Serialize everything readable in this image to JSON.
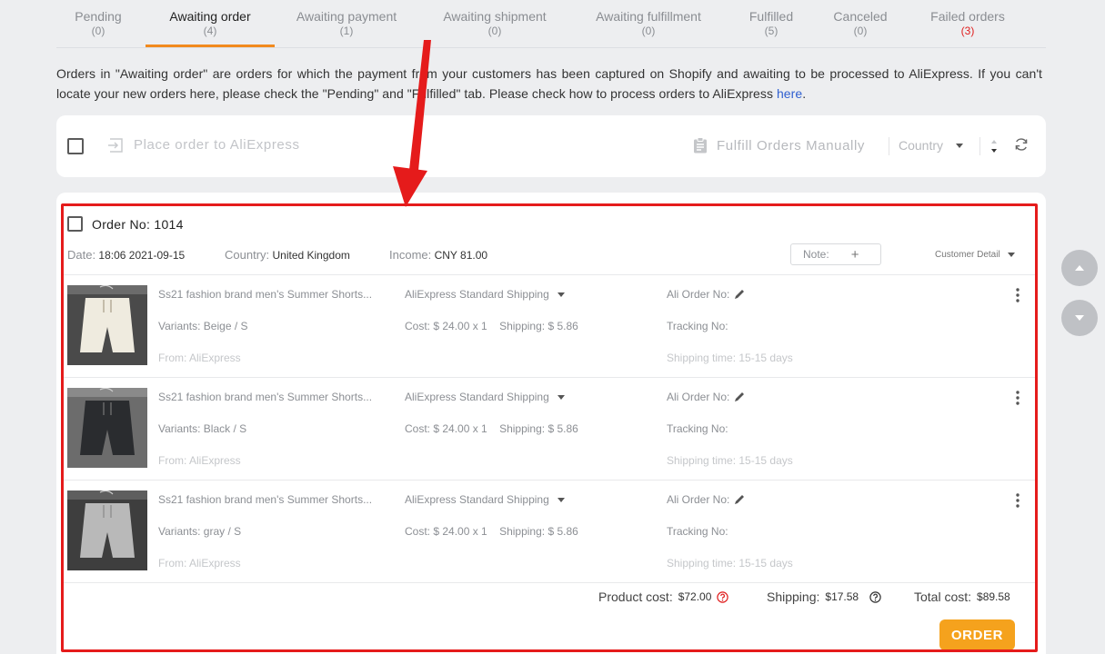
{
  "tabs": [
    {
      "label": "Pending",
      "count": "(0)"
    },
    {
      "label": "Awaiting order",
      "count": "(4)"
    },
    {
      "label": "Awaiting payment",
      "count": "(1)"
    },
    {
      "label": "Awaiting shipment",
      "count": "(0)"
    },
    {
      "label": "Awaiting fulfillment",
      "count": "(0)"
    },
    {
      "label": "Fulfilled",
      "count": "(5)"
    },
    {
      "label": "Canceled",
      "count": "(0)"
    },
    {
      "label": "Failed orders",
      "count": "(3)"
    }
  ],
  "active_tab": "Awaiting order",
  "info": {
    "text": "Orders in \"Awaiting order\" are orders for which the payment from your customers has been captured on Shopify and awaiting to be processed to AliExpress. If you can't locate your new orders here, please check the \"Pending\" and \"Fulfilled\" tab. Please check how to process orders to AliExpress",
    "link": "here",
    "end": "."
  },
  "toolbar": {
    "place_order": "Place order to AliExpress",
    "fulfill_manually": "Fulfill Orders Manually",
    "country": "Country"
  },
  "order": {
    "title": "Order No: 1014",
    "date_label": "Date:",
    "date": "18:06 2021-09-15",
    "country_label": "Country:",
    "country": "United Kingdom",
    "income_label": "Income:",
    "income": "CNY 81.00",
    "note": "Note:",
    "note_plus": "+",
    "customer_detail": "Customer Detail",
    "items": [
      {
        "title": "Ss21 fashion brand men's Summer Shorts...",
        "variant": "Variants: Beige / S",
        "from": "From: AliExpress",
        "shipping_method": "AliExpress Standard Shipping",
        "cost": "Cost: $ 24.00 x 1",
        "shipping": "Shipping: $ 5.86",
        "ali_order": "Ali Order No:",
        "tracking": "Tracking No:",
        "shipping_time": "Shipping time: 15-15 days",
        "color": "#efebdf"
      },
      {
        "title": "Ss21 fashion brand men's Summer Shorts...",
        "variant": "Variants: Black / S",
        "from": "From: AliExpress",
        "shipping_method": "AliExpress Standard Shipping",
        "cost": "Cost: $ 24.00 x 1",
        "shipping": "Shipping: $ 5.86",
        "ali_order": "Ali Order No:",
        "tracking": "Tracking No:",
        "shipping_time": "Shipping time: 15-15 days",
        "color": "#2a2c2f"
      },
      {
        "title": "Ss21 fashion brand men's Summer Shorts...",
        "variant": "Variants: gray / S",
        "from": "From: AliExpress",
        "shipping_method": "AliExpress Standard Shipping",
        "cost": "Cost: $ 24.00 x 1",
        "shipping": "Shipping: $ 5.86",
        "ali_order": "Ali Order No:",
        "tracking": "Tracking No:",
        "shipping_time": "Shipping time: 15-15 days",
        "color": "#b9b9b9"
      }
    ],
    "product_cost_label": "Product cost:",
    "product_cost": "$72.00",
    "shipping_label": "Shipping:",
    "shipping_total": "$17.58",
    "total_cost_label": "Total cost:",
    "total_cost": "$89.58",
    "order_button": "ORDER"
  },
  "colors": {
    "accent": "#f28a1e",
    "order_button": "#f5a21d",
    "highlight": "#e51b1b",
    "failed_count": "#e01e1e",
    "link": "#2f5fd0"
  }
}
